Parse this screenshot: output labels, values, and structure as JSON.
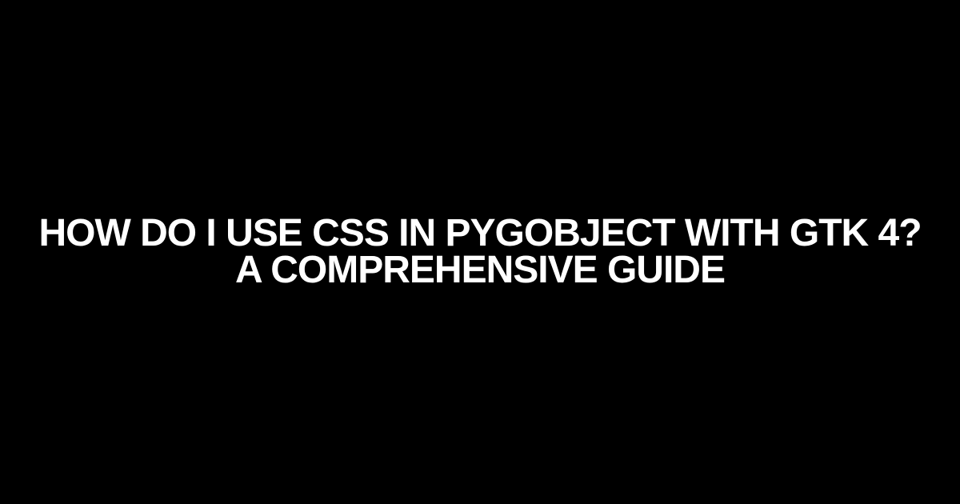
{
  "title": {
    "line1": "How do I use CSS in PyGObject with Gtk 4?",
    "line2": "A Comprehensive Guide"
  },
  "colors": {
    "background": "#000000",
    "text": "#ffffff"
  }
}
